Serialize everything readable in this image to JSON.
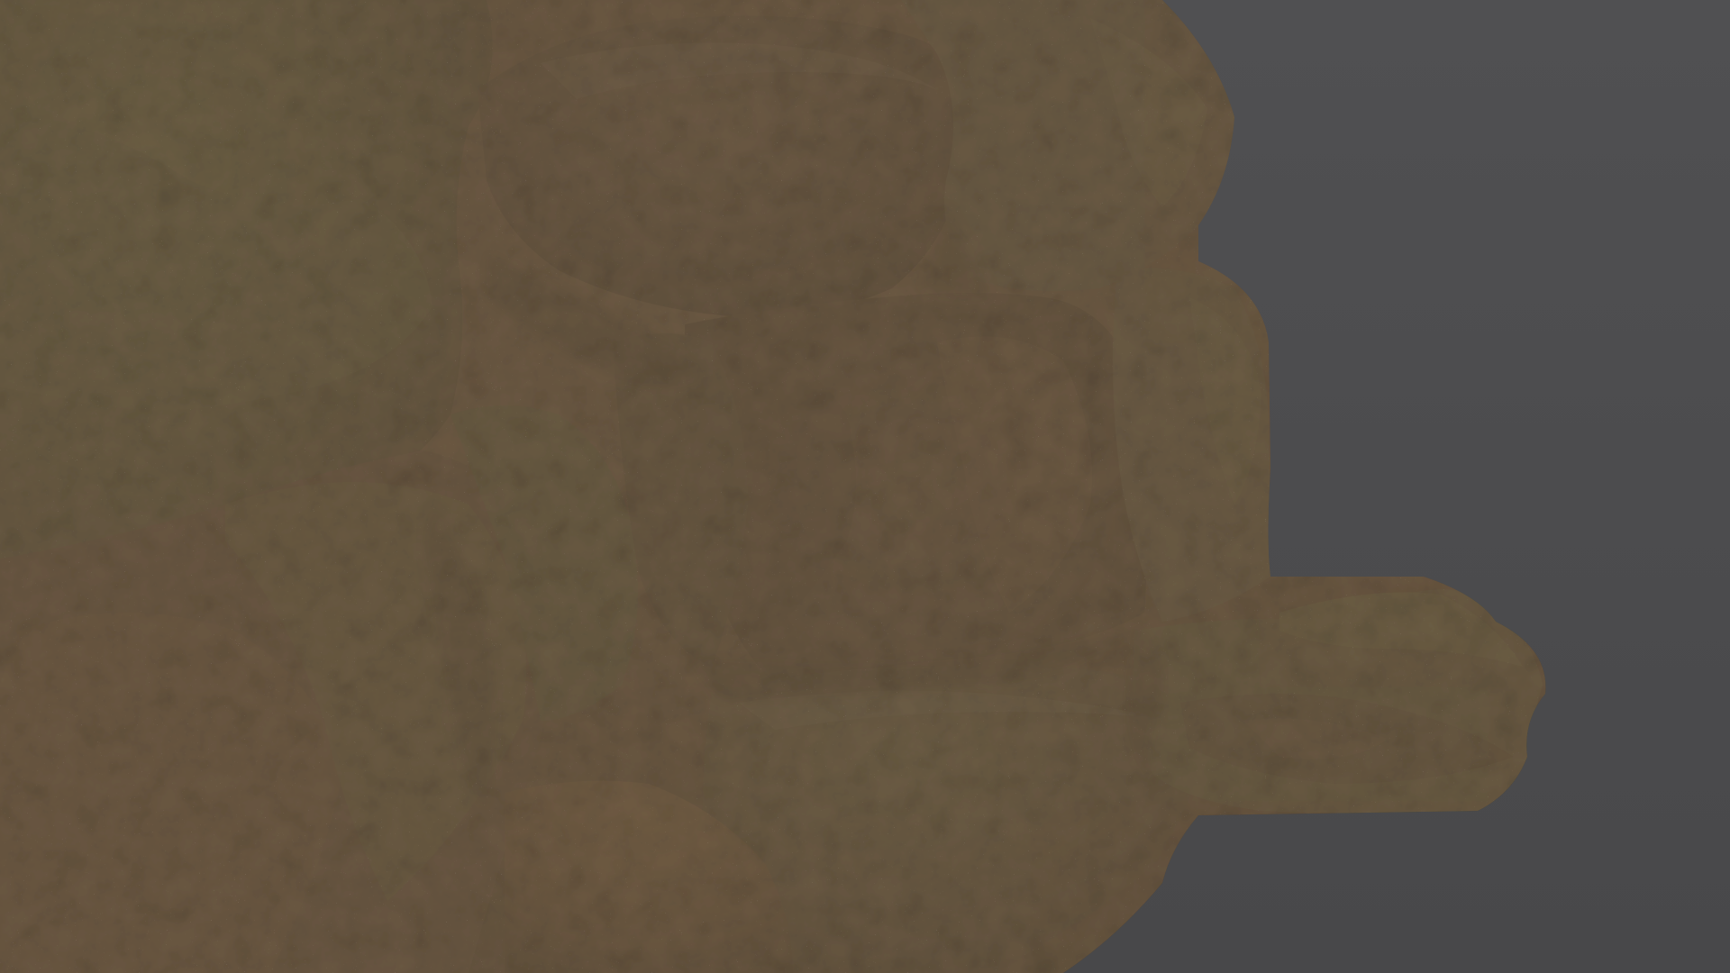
{
  "scene": {
    "subject": "rock-formation",
    "background_color": "#4d4d4f",
    "palette": {
      "moss_light": "#6f8a45",
      "moss": "#5a6f38",
      "moss_dark": "#3c4a28",
      "rock_brown": "#6a4a34",
      "rock_dark": "#3a2a20",
      "rock_warm": "#8a5f3e",
      "highlight": "#b7b0a0",
      "shadow": "#1a1410"
    }
  }
}
